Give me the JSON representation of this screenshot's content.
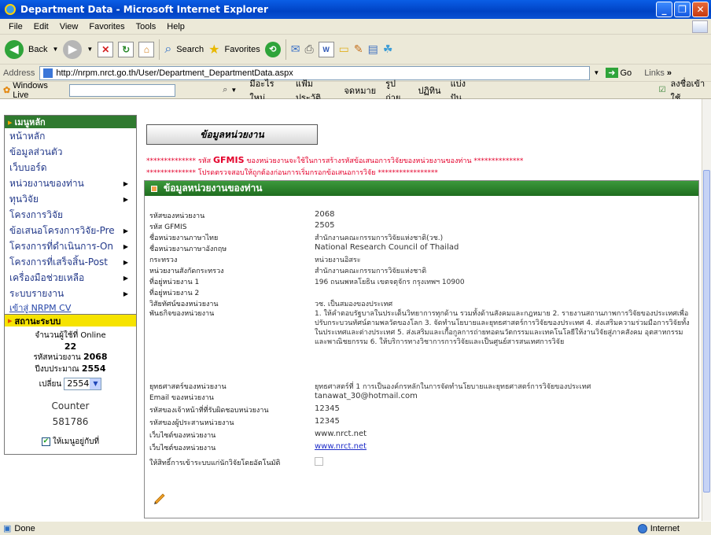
{
  "window": {
    "title": "Department Data - Microsoft Internet Explorer"
  },
  "menu": [
    "File",
    "Edit",
    "View",
    "Favorites",
    "Tools",
    "Help"
  ],
  "toolbar": {
    "back": "Back",
    "search": "Search",
    "favorites": "Favorites"
  },
  "address": {
    "label": "Address",
    "url": "http://nrpm.nrct.go.th/User/Department_DepartmentData.aspx",
    "go": "Go",
    "links": "Links"
  },
  "linksbar": {
    "windows_live": "Windows Live",
    "items": [
      "มีอะไรใหม่",
      "แฟ้มประวัติ",
      "จดหมาย",
      "รูปถ่าย",
      "ปฏิทิน",
      "แบ่งปัน"
    ],
    "signin": "ลงชื่อเข้าใช้"
  },
  "leftmenu": {
    "header": "เมนูหลัก",
    "items": [
      {
        "label": "หน้าหลัก",
        "sub": false
      },
      {
        "label": "ข้อมูลส่วนตัว",
        "sub": false
      },
      {
        "label": "เว็บบอร์ด",
        "sub": false
      },
      {
        "label": "หน่วยงานของท่าน",
        "sub": true
      },
      {
        "label": "ทุนวิจัย",
        "sub": true
      },
      {
        "label": "โครงการวิจัย",
        "sub": false
      },
      {
        "label": "ข้อเสนอโครงการวิจัย-Pre",
        "sub": true
      },
      {
        "label": "โครงการที่ดำเนินการ-On",
        "sub": true
      },
      {
        "label": "โครงการที่เสร็จสิ้น-Post",
        "sub": true
      },
      {
        "label": "เครื่องมือช่วยเหลือ",
        "sub": true
      },
      {
        "label": "ระบบรายงาน",
        "sub": true
      }
    ],
    "cv_link": "เข้าสู่ NRPM CV"
  },
  "status": {
    "header": "สถานะระบบ",
    "online_label": "จำนวนผู้ใช้ที่ Online",
    "online_count": "22",
    "dept_label": "รหัสหน่วยงาน",
    "dept_code": "2068",
    "budget_label": "ปีงบประมาณ",
    "budget_year": "2554",
    "change_label": "เปลี่ยน",
    "year_select": "2554",
    "counter_label": "Counter",
    "counter_value": "581786",
    "stay_label": "ให้เมนูอยู่กับที่"
  },
  "main": {
    "page_title": "ข้อมูลหน่วยงาน",
    "note1_stars": "**************",
    "note1_pre": " รหัส ",
    "note1_bold": "GFMIS",
    "note1_post": " ของหน่วยงานจะใช้ในการสร้างรหัสข้อเสนอการวิจัยของหน่วยงานของท่าน ",
    "note1_stars_end": "**************",
    "note2_stars": "**************",
    "note2_text": " โปรดตรวจสอบให้ถูกต้องก่อนการเริ่มกรอกข้อเสนอการวิจัย ",
    "note2_stars_end": "*****************",
    "panel_title": "ข้อมูลหน่วยงานของท่าน",
    "fields": [
      {
        "label": "รหัสของหน่วยงาน",
        "value": "2068"
      },
      {
        "label": "รหัส GFMIS",
        "value": "2505"
      },
      {
        "label": "ชื่อหน่วยงานภาษาไทย",
        "value": "สำนักงานคณะกรรมการวิจัยแห่งชาติ(วช.)"
      },
      {
        "label": "ชื่อหน่วยงานภาษาอังกฤษ",
        "value": "National Research Council of Thailad"
      },
      {
        "label": "กระทรวง",
        "value": "หน่วยงานอิสระ"
      },
      {
        "label": "หน่วยงานสังกัดกระทรวง",
        "value": "สำนักงานคณะกรรมการวิจัยแห่งชาติ"
      },
      {
        "label": "ที่อยู่หน่วยงาน 1",
        "value": "196 ถนนพหลโยธิน เขตจตุจักร กรุงเทพฯ 10900"
      },
      {
        "label": "ที่อยู่หน่วยงาน 2",
        "value": ""
      },
      {
        "label": "วิสัยทัศน์ของหน่วยงาน",
        "value": "วช. เป็นสมองของประเทศ"
      },
      {
        "label": "พันธกิจของหน่วยงาน",
        "value": "1. ให้คำตอบรัฐบาลในประเด็นวิทยาการทุกด้าน รวมทั้งด้านสังคมและกฎหมาย 2. รายงานสถานภาพการวิจัยของประเทศเพื่อปรับกระบวนทัศน์ตามพลวัตของโลก 3. จัดทำนโยบายและยุทธศาสตร์การวิจัยของประเทศ 4. ส่งเสริมความร่วมมือการวิจัยทั้งในประเทศและต่างประเทศ 5. ส่งเสริมและเกื้อกูลการถ่ายทอดนวัตกรรมและเทคโนโลยีให้งานวิจัยสู่ภาคสังคม อุตสาหกรรมและพาณิชยกรรม 6. ให้บริการทางวิชาการการวิจัยและเป็นศูนย์สารสนเทศการวิจัย"
      },
      {
        "label": "ยุทธศาสตร์ของหน่วยงาน",
        "value": "ยุทธศาสตร์ที่ 1 การเป็นองค์กรหลักในการจัดทำนโยบายและยุทธศาสตร์การวิจัยของประเทศ"
      },
      {
        "label": "Email ของหน่วยงาน",
        "value": "tanawat_30@hotmail.com"
      },
      {
        "label": "รหัสของเจ้าหน้าที่ที่รับผิดชอบหน่วยงาน",
        "value": "12345"
      },
      {
        "label": "รหัสของผู้ประสานหน่วยงาน",
        "value": "12345"
      },
      {
        "label": "เว็บไซต์ของหน่วยงาน",
        "value": "www.nrct.net"
      },
      {
        "label": "เว็บไซต์ของหน่วยงาน",
        "value": "www.nrct.net"
      },
      {
        "label": "ให้สิทธิ์การเข้าระบบแก่นักวิจัยโดยอัตโนมัติ",
        "value": ""
      }
    ]
  },
  "statusbar": {
    "left": "Done",
    "zone": "Internet"
  }
}
